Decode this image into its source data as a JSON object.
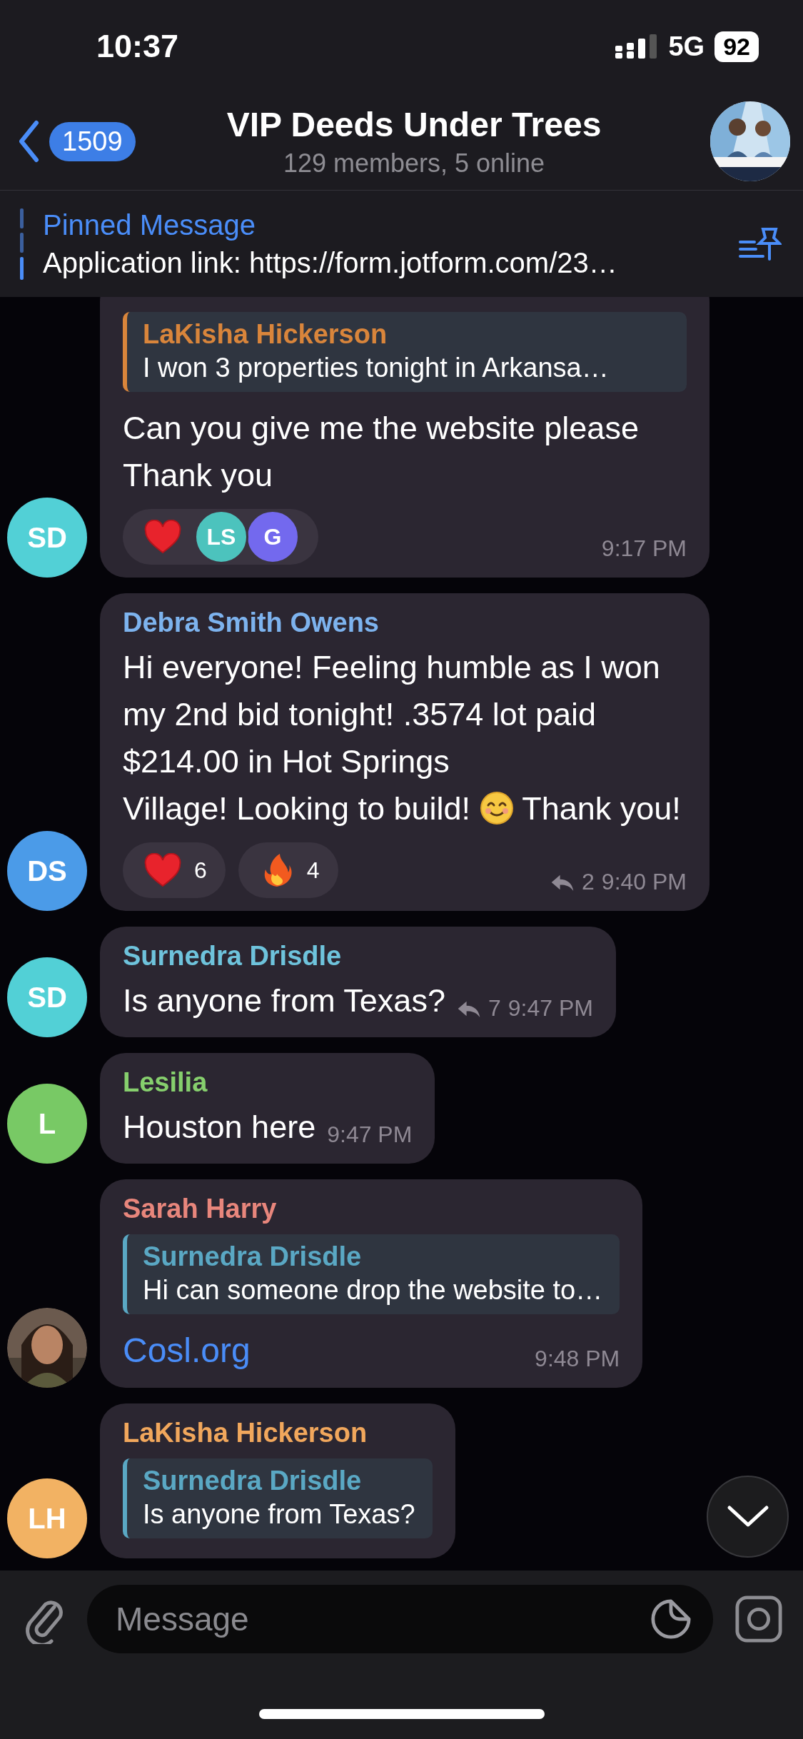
{
  "status_bar": {
    "time": "10:37",
    "network": "5G",
    "battery": "92"
  },
  "header": {
    "back_count": "1509",
    "title": "VIP Deeds Under Trees",
    "subtitle": "129 members, 5 online",
    "avatar": {
      "kind": "picture"
    }
  },
  "pinned": {
    "label": "Pinned Message",
    "text": "Application link: https://form.jotform.com/23…"
  },
  "messages": [
    {
      "avatar": {
        "kind": "initials",
        "initials": "SD",
        "color": "#52d0d6"
      },
      "reply": {
        "name": "LaKisha Hickerson",
        "text": "I won 3 properties tonight in Arkansa…",
        "color": "#d9853b"
      },
      "content": [
        {
          "kind": "paragraph",
          "text": "Can you give me the website please Thank you"
        }
      ],
      "reactions": [
        {
          "kind": "heart",
          "users": [
            {
              "initials": "LS",
              "color": "#4cc3bd"
            },
            {
              "initials": "G",
              "color": "#7369ee"
            }
          ]
        }
      ],
      "time": "9:17 PM"
    },
    {
      "avatar": {
        "kind": "initials",
        "initials": "DS",
        "color": "#4b9be8"
      },
      "sender": {
        "name": "Debra Smith Owens",
        "color": "#7db3ee"
      },
      "content": [
        {
          "kind": "paragraph",
          "text": "Hi everyone! Feeling humble as I won my 2nd bid tonight! .3574 lot paid $214.00 in Hot Springs"
        },
        {
          "kind": "text",
          "text": "Village! Looking to build!"
        },
        {
          "kind": "emoji"
        },
        {
          "kind": "text",
          "text": "Thank you!"
        }
      ],
      "reactions": [
        {
          "kind": "heart",
          "count": "6"
        },
        {
          "kind": "fire",
          "count": "4"
        }
      ],
      "replies": "2",
      "time": "9:40 PM"
    },
    {
      "avatar": {
        "kind": "initials",
        "initials": "SD",
        "color": "#52d0d6"
      },
      "sender": {
        "name": "Surnedra Drisdle",
        "color": "#6ec3dc"
      },
      "content": [
        {
          "kind": "text",
          "text": "Is anyone from Texas?"
        }
      ],
      "replies": "7",
      "time": "9:47 PM"
    },
    {
      "avatar": {
        "kind": "initials",
        "initials": "L",
        "color": "#78c965"
      },
      "sender": {
        "name": "Lesilia",
        "color": "#86cf6d"
      },
      "content": [
        {
          "kind": "text",
          "text": "Houston here"
        }
      ],
      "time": "9:47 PM"
    },
    {
      "avatar": {
        "kind": "picture"
      },
      "sender": {
        "name": "Sarah Harry",
        "color": "#e8867c"
      },
      "reply": {
        "name": "Surnedra Drisdle",
        "text": "Hi can someone drop the website to…",
        "color": "#5aa8c4"
      },
      "content": [
        {
          "kind": "link",
          "text": "Cosl.org"
        }
      ],
      "time": "9:48 PM"
    },
    {
      "avatar": {
        "kind": "initials",
        "initials": "LH",
        "color": "#f2b263"
      },
      "sender": {
        "name": "LaKisha Hickerson",
        "color": "#f1a75c"
      },
      "reply": {
        "name": "Surnedra Drisdle",
        "text": "Is anyone from Texas?",
        "color": "#5aa8c4"
      }
    }
  ],
  "composer": {
    "placeholder": "Message"
  }
}
